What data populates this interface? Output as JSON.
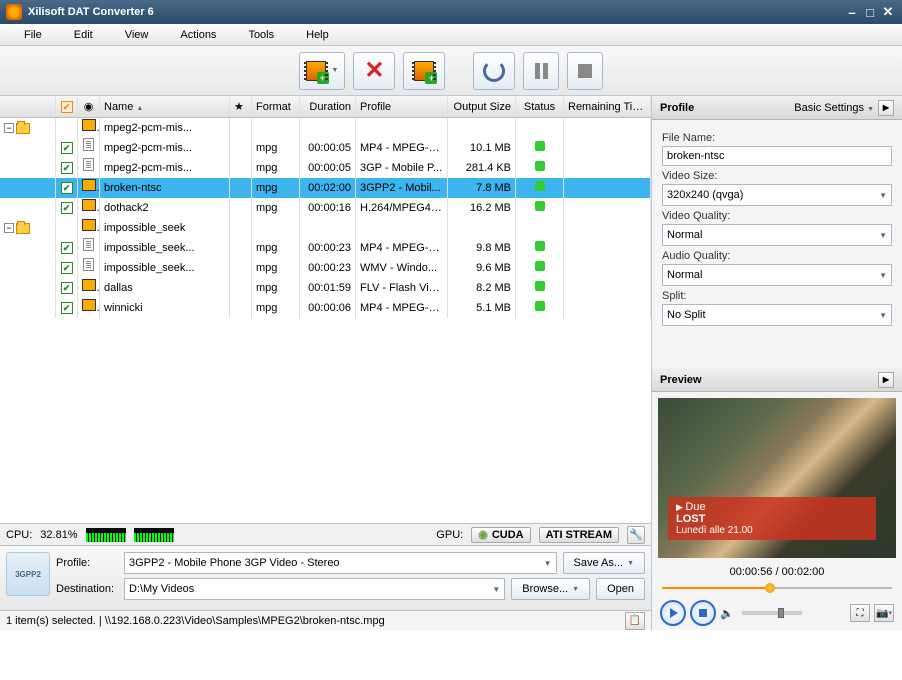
{
  "window": {
    "title": "Xilisoft DAT Converter 6"
  },
  "menu": [
    "File",
    "Edit",
    "View",
    "Actions",
    "Tools",
    "Help"
  ],
  "columns": {
    "name": "Name",
    "format": "Format",
    "duration": "Duration",
    "profile": "Profile",
    "output": "Output Size",
    "status": "Status",
    "remaining": "Remaining Time"
  },
  "rows": [
    {
      "type": "group",
      "name": "mpeg2-pcm-mis...",
      "expanded": true
    },
    {
      "type": "item",
      "indent": 1,
      "name": "mpeg2-pcm-mis...",
      "format": "mpg",
      "duration": "00:00:05",
      "profile": "MP4 - MPEG-4 ...",
      "output": "10.1 MB"
    },
    {
      "type": "item",
      "indent": 1,
      "name": "mpeg2-pcm-mis...",
      "format": "mpg",
      "duration": "00:00:05",
      "profile": "3GP - Mobile P...",
      "output": "281.4 KB"
    },
    {
      "type": "item",
      "indent": 0,
      "selected": true,
      "name": "broken-ntsc",
      "format": "mpg",
      "duration": "00:02:00",
      "profile": "3GPP2 - Mobil...",
      "output": "7.8 MB"
    },
    {
      "type": "item",
      "indent": 0,
      "name": "dothack2",
      "format": "mpg",
      "duration": "00:00:16",
      "profile": "H.264/MPEG4 ...",
      "output": "16.2 MB"
    },
    {
      "type": "group",
      "name": "impossible_seek",
      "expanded": true
    },
    {
      "type": "item",
      "indent": 1,
      "name": "impossible_seek...",
      "format": "mpg",
      "duration": "00:00:23",
      "profile": "MP4 - MPEG-4 ...",
      "output": "9.8 MB"
    },
    {
      "type": "item",
      "indent": 1,
      "name": "impossible_seek...",
      "format": "mpg",
      "duration": "00:00:23",
      "profile": "WMV - Windo...",
      "output": "9.6 MB"
    },
    {
      "type": "item",
      "indent": 0,
      "name": "dallas",
      "format": "mpg",
      "duration": "00:01:59",
      "profile": "FLV - Flash Vid...",
      "output": "8.2 MB"
    },
    {
      "type": "item",
      "indent": 0,
      "name": "winnicki",
      "format": "mpg",
      "duration": "00:00:06",
      "profile": "MP4 - MPEG-4 ...",
      "output": "5.1 MB"
    }
  ],
  "cpu": {
    "label": "CPU:",
    "value": "32.81%"
  },
  "gpu": {
    "label": "GPU:",
    "cuda": "CUDA",
    "ati": "ATI STREAM"
  },
  "profileBar": {
    "profileLabel": "Profile:",
    "profileValue": "3GPP2 - Mobile Phone 3GP Video - Stereo",
    "destLabel": "Destination:",
    "destValue": "D:\\My Videos",
    "saveAs": "Save As...",
    "browse": "Browse...",
    "open": "Open"
  },
  "statusBar": "1 item(s) selected. | \\\\192.168.0.223\\Video\\Samples\\MPEG2\\broken-ntsc.mpg",
  "sidePanel": {
    "profileTitle": "Profile",
    "basicSettings": "Basic Settings",
    "fileNameLabel": "File Name:",
    "fileName": "broken-ntsc",
    "videoSizeLabel": "Video Size:",
    "videoSize": "320x240 (qvga)",
    "videoQualityLabel": "Video Quality:",
    "videoQuality": "Normal",
    "audioQualityLabel": "Audio Quality:",
    "audioQuality": "Normal",
    "splitLabel": "Split:",
    "split": "No Split",
    "previewTitle": "Preview"
  },
  "preview": {
    "channel": "Due",
    "show": "LOST",
    "time": "Lunedì alle 21.00",
    "position": "00:00:56",
    "duration": "00:02:00"
  }
}
